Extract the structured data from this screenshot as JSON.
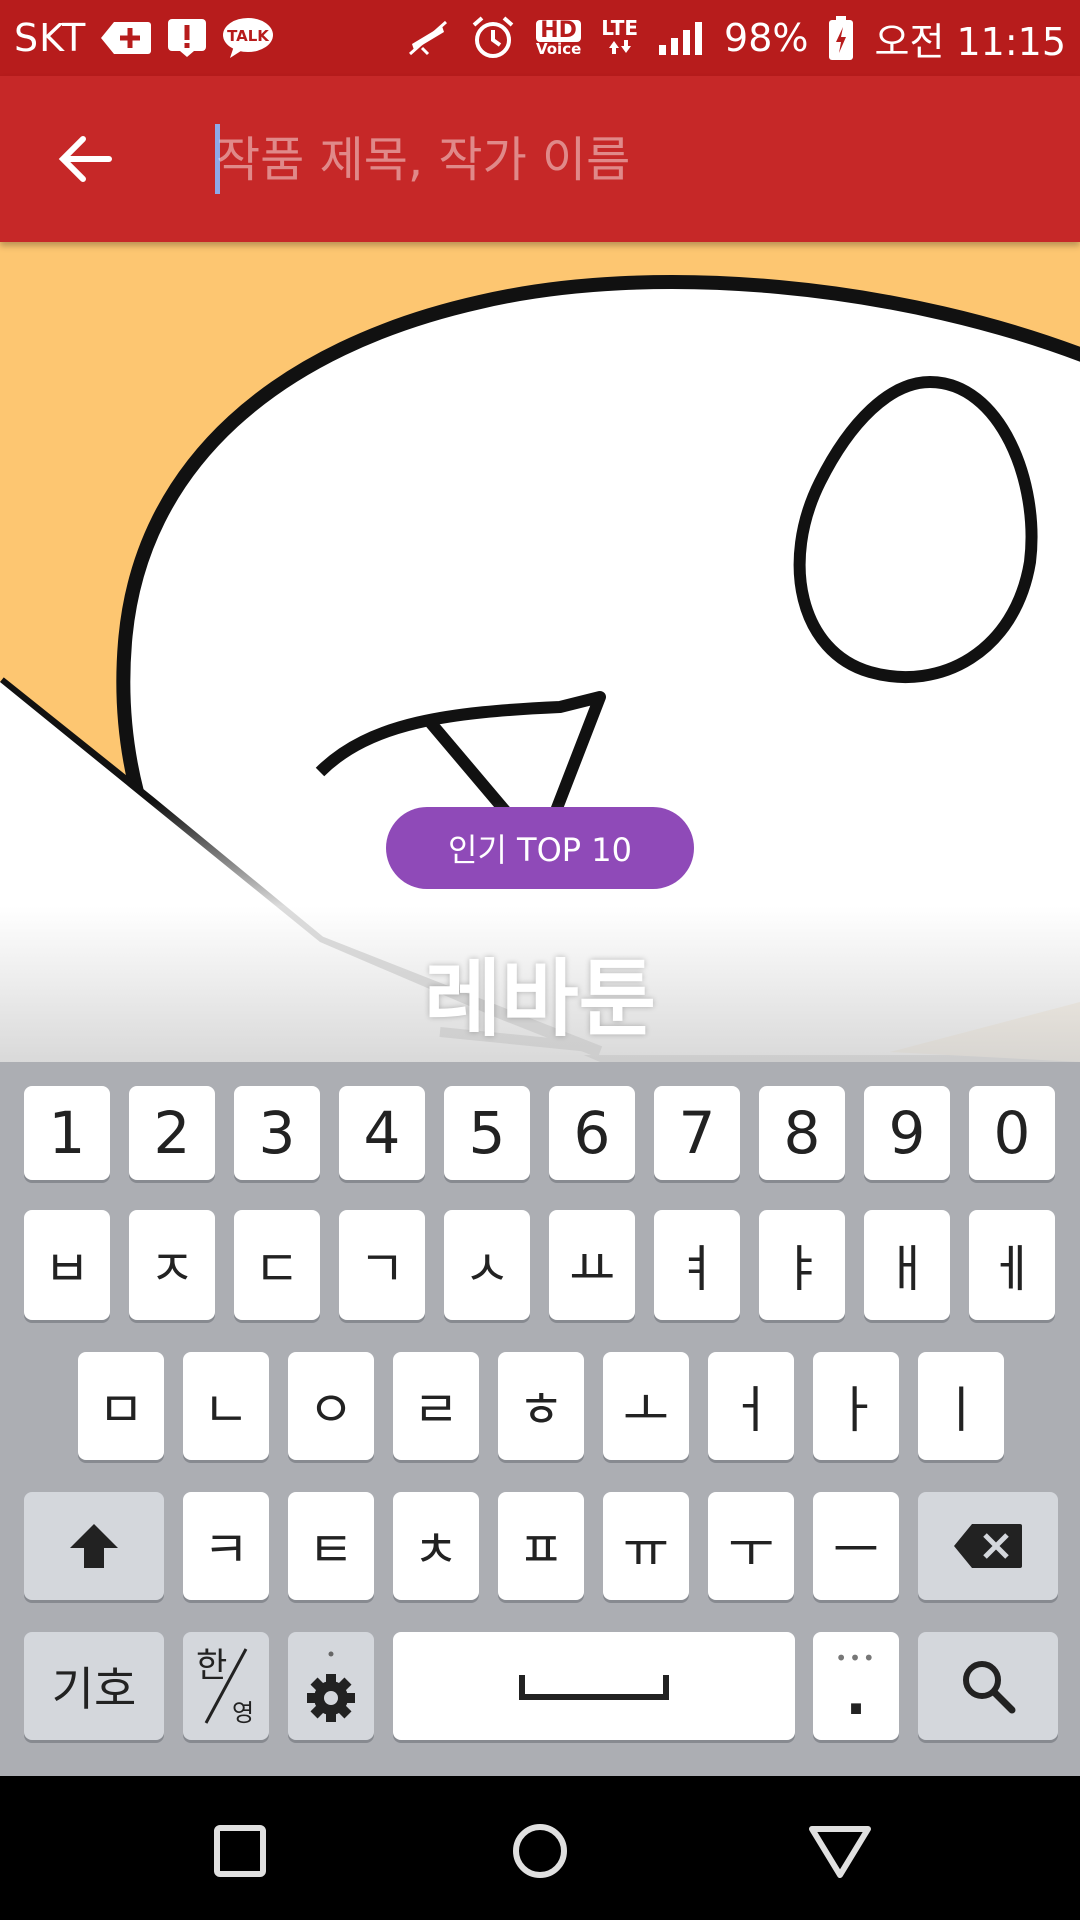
{
  "status_bar": {
    "carrier": "SKT",
    "hd_voice_top": "HD",
    "hd_voice_bottom": "Voice",
    "network": "LTE",
    "battery_percent": "98%",
    "time": "오전 11:15",
    "talk_label": "TALK"
  },
  "search": {
    "placeholder": "작품 제목, 작가 이름",
    "value": ""
  },
  "banner": {
    "badge": "인기 TOP 10",
    "title": "레바툰"
  },
  "keyboard": {
    "row1": [
      "1",
      "2",
      "3",
      "4",
      "5",
      "6",
      "7",
      "8",
      "9",
      "0"
    ],
    "row2": [
      "ㅂ",
      "ㅈ",
      "ㄷ",
      "ㄱ",
      "ㅅ",
      "ㅛ",
      "ㅕ",
      "ㅑ",
      "ㅐ",
      "ㅔ"
    ],
    "row3": [
      "ㅁ",
      "ㄴ",
      "ㅇ",
      "ㄹ",
      "ㅎ",
      "ㅗ",
      "ㅓ",
      "ㅏ",
      "ㅣ"
    ],
    "row4": [
      "ㅋ",
      "ㅌ",
      "ㅊ",
      "ㅍ",
      "ㅠ",
      "ㅜ",
      "ㅡ"
    ],
    "symbols_label": "기호",
    "lang_top": "한",
    "lang_bottom": "영",
    "period_label": "."
  },
  "colors": {
    "status_bar": "#b71c1c",
    "app_bar": "#c62828",
    "badge": "#8f4ab8",
    "banner_bg": "#fdc671",
    "keyboard_bg": "#acaeb3"
  }
}
